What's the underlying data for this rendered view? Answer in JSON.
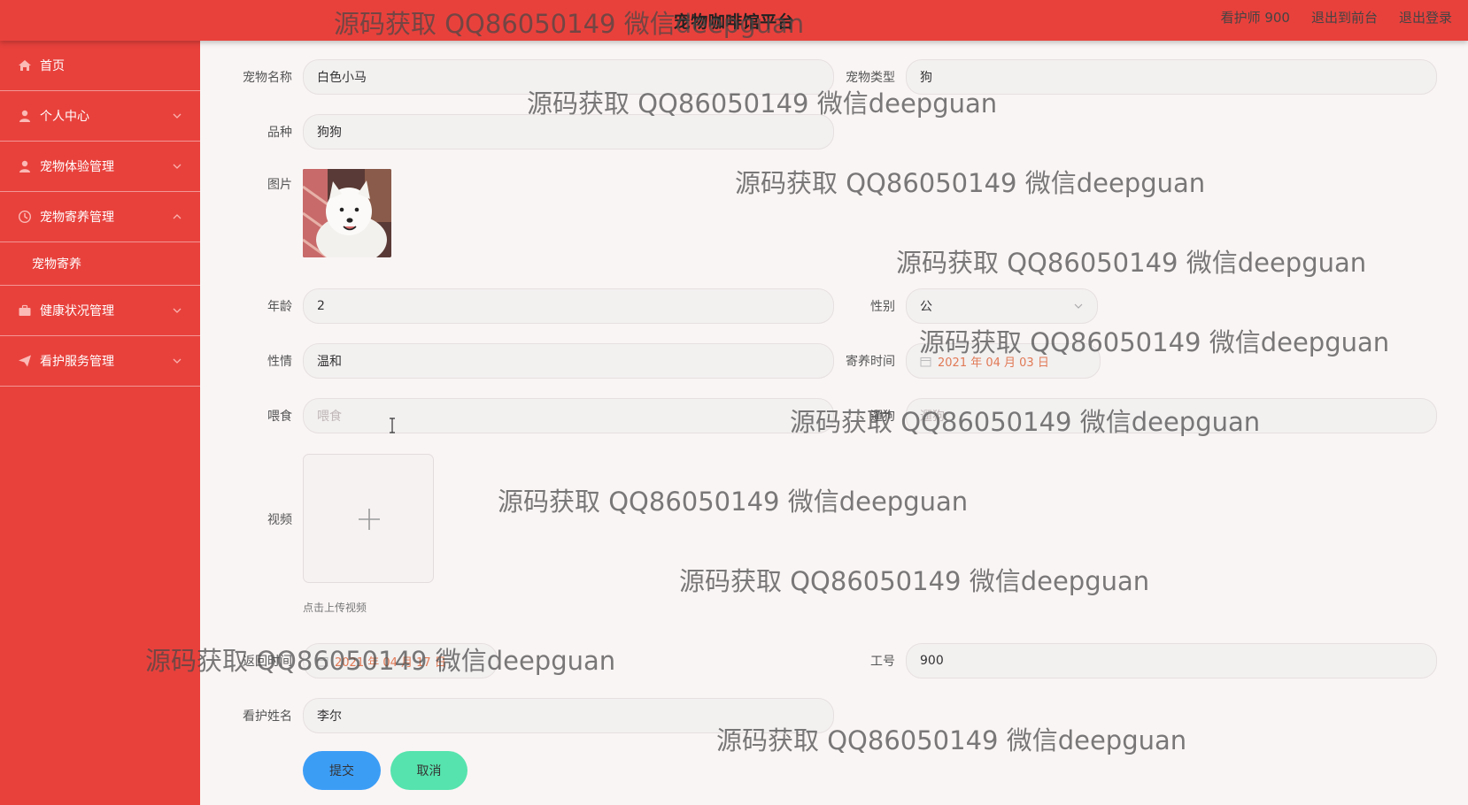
{
  "header": {
    "title": "宠物咖啡馆平台",
    "user_label": "看护师 900",
    "back_to_front": "退出到前台",
    "logout": "退出登录"
  },
  "sidebar": {
    "items": [
      {
        "label": "首页",
        "icon": "home-icon"
      },
      {
        "label": "个人中心",
        "icon": "user-icon"
      },
      {
        "label": "宠物体验管理",
        "icon": "user-icon"
      },
      {
        "label": "宠物寄养管理",
        "icon": "clock-icon",
        "expanded": true,
        "children": [
          {
            "label": "宠物寄养"
          }
        ]
      },
      {
        "label": "健康状况管理",
        "icon": "briefcase-icon"
      },
      {
        "label": "看护服务管理",
        "icon": "send-icon"
      }
    ]
  },
  "form": {
    "pet_name": {
      "label": "宠物名称",
      "value": "白色小马"
    },
    "pet_type": {
      "label": "宠物类型",
      "value": "狗"
    },
    "breed": {
      "label": "品种",
      "value": "狗狗"
    },
    "image": {
      "label": "图片"
    },
    "age": {
      "label": "年龄",
      "value": "2"
    },
    "gender": {
      "label": "性别",
      "value": "公"
    },
    "temperament": {
      "label": "性情",
      "value": "温和"
    },
    "boarding_time": {
      "label": "寄养时间",
      "value": "2021 年 04 月 03 日"
    },
    "feeding": {
      "label": "喂食",
      "placeholder": "喂食"
    },
    "walk": {
      "label": "遛狗",
      "placeholder": "遛狗"
    },
    "video": {
      "label": "视频",
      "hint": "点击上传视频"
    },
    "return_time": {
      "label": "返回时间",
      "value": "2021 年 04 月 17 日"
    },
    "staff_no": {
      "label": "工号",
      "value": "900"
    },
    "caretaker": {
      "label": "看护姓名",
      "value": "李尔"
    }
  },
  "buttons": {
    "submit": "提交",
    "cancel": "取消"
  },
  "watermark": "源码获取 QQ86050149 微信deepguan",
  "colors": {
    "primary": "#e8413c",
    "submit": "#3c9df5",
    "cancel": "#56e3ad",
    "date_text": "#e07a55"
  }
}
